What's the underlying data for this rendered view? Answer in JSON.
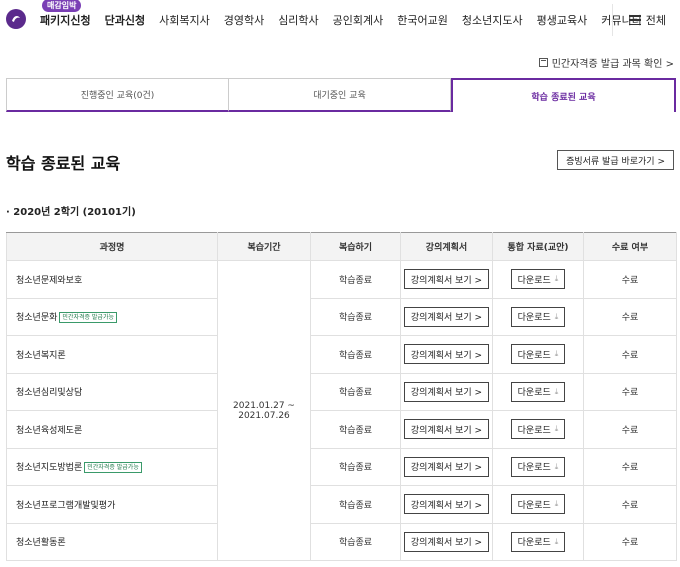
{
  "nav": {
    "badge": "매감임박",
    "items": [
      {
        "label": "패키지신청",
        "bold": true
      },
      {
        "label": "단과신청",
        "bold": true
      },
      {
        "label": "사회복지사",
        "bold": false
      },
      {
        "label": "경영학사",
        "bold": false
      },
      {
        "label": "심리학사",
        "bold": false
      },
      {
        "label": "공인회계사",
        "bold": false
      },
      {
        "label": "한국어교원",
        "bold": false
      },
      {
        "label": "청소년지도사",
        "bold": false
      },
      {
        "label": "평생교육사",
        "bold": false
      },
      {
        "label": "커뮤니티",
        "bold": false
      }
    ],
    "all_label": "전체"
  },
  "private_link": "민간자격증 발급 과목 확인 >",
  "tabs": [
    {
      "label": "진행중인 교육(0건)",
      "active": false
    },
    {
      "label": "대기중인 교육",
      "active": false
    },
    {
      "label": "학습 종료된 교육",
      "active": true
    }
  ],
  "section_title": "학습 종료된 교육",
  "cert_button": "증빙서류 발급 바로가기 >",
  "term_title": "· 2020년 2학기 (20101기)",
  "table": {
    "headers": [
      "과정명",
      "복습기간",
      "복습하기",
      "강의계획서",
      "통합 자료(교안)",
      "수료 여부"
    ],
    "review_period": "2021.01.27 ~ 2021.07.26",
    "plan_label": "강의계획서 보기 >",
    "download_label": "다운로드",
    "tag_label": "민간자격증 발급가능",
    "rows": [
      {
        "course": "청소년문제와보호",
        "tag": false,
        "review": "학습종료",
        "status": "수료"
      },
      {
        "course": "청소년문화",
        "tag": true,
        "review": "학습종료",
        "status": "수료"
      },
      {
        "course": "청소년복지론",
        "tag": false,
        "review": "학습종료",
        "status": "수료"
      },
      {
        "course": "청소년심리및상담",
        "tag": false,
        "review": "학습종료",
        "status": "수료"
      },
      {
        "course": "청소년육성제도론",
        "tag": false,
        "review": "학습종료",
        "status": "수료"
      },
      {
        "course": "청소년지도방법론",
        "tag": true,
        "review": "학습종료",
        "status": "수료"
      },
      {
        "course": "청소년프로그램개발및평가",
        "tag": false,
        "review": "학습종료",
        "status": "수료"
      },
      {
        "course": "청소년활동론",
        "tag": false,
        "review": "학습종료",
        "status": "수료"
      }
    ]
  },
  "colors": {
    "accent": "#6a2aa0",
    "tag_green": "#1f7a4a"
  }
}
